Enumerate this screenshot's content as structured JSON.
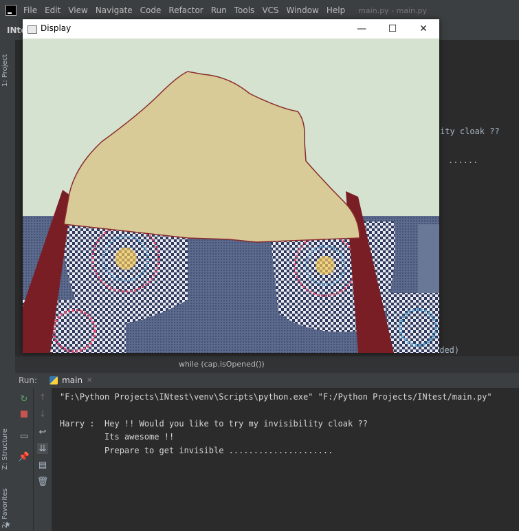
{
  "ide": {
    "menu": [
      {
        "label": "File"
      },
      {
        "label": "Edit"
      },
      {
        "label": "View"
      },
      {
        "label": "Navigate"
      },
      {
        "label": "Code"
      },
      {
        "label": "Refactor"
      },
      {
        "label": "Run"
      },
      {
        "label": "Tools"
      },
      {
        "label": "VCS"
      },
      {
        "label": "Window"
      },
      {
        "label": "Help"
      }
    ],
    "window_title": "main.py - main.py",
    "project_name": "INte",
    "side_tabs": {
      "project": "1: Project",
      "structure": "Z: Structure",
      "favorites": "2: Favorites"
    },
    "editor_fragments": {
      "line1": "ity cloak ??",
      "line2": "......",
      "line3": "eded)"
    },
    "status_line": "while (cap.isOpened())",
    "run": {
      "label": "Run:",
      "tab": "main"
    },
    "console": {
      "line1": "\"F:\\Python Projects\\INtest\\venv\\Scripts\\python.exe\" \"F:/Python Projects/INtest/main.py\"",
      "line2": "Harry :  Hey !! Would you like to try my invisibility cloak ??",
      "line3": "         Its awesome !!",
      "line4": "         Prepare to get invisible ....................."
    }
  },
  "display_window": {
    "title": "Display",
    "minimize_icon": "minimize-icon",
    "maximize_icon": "maximize-icon",
    "close_icon": "close-icon"
  },
  "colors": {
    "ide_bg": "#2b2b2b",
    "ide_panel": "#3c3f41",
    "wall": "#d4e2cf",
    "cloak": "#d8cb98",
    "sofa_blue": "#5b6a8e",
    "checker_dark": "#2f3b5e",
    "red_strap": "#7a1e26"
  }
}
